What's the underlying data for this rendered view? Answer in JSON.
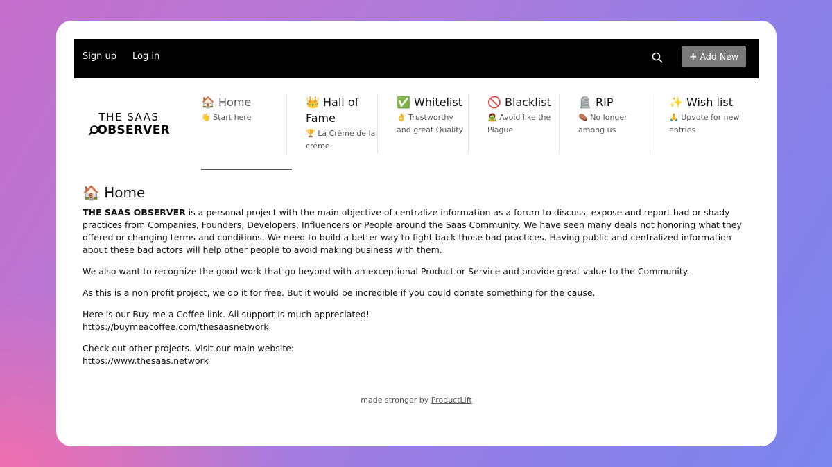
{
  "topbar": {
    "signup_label": "Sign up",
    "login_label": "Log in",
    "search_icon": "search-icon",
    "add_new_label": "Add New"
  },
  "logo": {
    "line1": "THE SAAS",
    "line2": "OBSERVER"
  },
  "tabs": [
    {
      "emoji": "🏠",
      "title": "Home",
      "sub_emoji": "👋",
      "sub": "Start here",
      "active": true
    },
    {
      "emoji": "👑",
      "title": "Hall of Fame",
      "sub_emoji": "🏆",
      "sub": "La Crême de la créme",
      "active": false
    },
    {
      "emoji": "✅",
      "title": "Whitelist",
      "sub_emoji": "👌",
      "sub": "Trustworthy and great Quality",
      "active": false
    },
    {
      "emoji": "🚫",
      "title": "Blacklist",
      "sub_emoji": "🧟",
      "sub": "Avoid like the Plague",
      "active": false
    },
    {
      "emoji": "🪦",
      "title": "RIP",
      "sub_emoji": "⚰️",
      "sub": "No longer among us",
      "active": false
    },
    {
      "emoji": "✨",
      "title": "Wish list",
      "sub_emoji": "🙏",
      "sub": "Upvote for new entries",
      "active": false
    }
  ],
  "main": {
    "heading_emoji": "🏠",
    "heading": "Home",
    "intro_bold": "THE SAAS OBSERVER",
    "intro_rest": " is a personal project with the main objective of centralize information as a forum to discuss, expose and report bad or shady practices from Companies, Founders, Developers, Influencers or People around the Saas Community. We have seen many deals not honoring what they offered or changing terms and conditions. We need to build a better way to fight back those bad practices. Having public and centralized information about these bad actors will help other people to avoid making business with them.",
    "p2": "We also want to recognize the good work that go beyond with an exceptional Product or Service and provide great value to the Community.",
    "p3": "As this is a non profit project, we do it for free. But it would be incredible if you could donate something for the cause.",
    "p4_line1": "Here is our Buy me a Coffee link. All support is much appreciated!",
    "p4_line2": "https://buymeacoffee.com/thesaasnetwork",
    "p5_line1": "Check out other projects. Visit our main website:",
    "p5_line2": "https://www.thesaas.network"
  },
  "footer": {
    "prefix": "made stronger by",
    "link": "ProductLift"
  }
}
